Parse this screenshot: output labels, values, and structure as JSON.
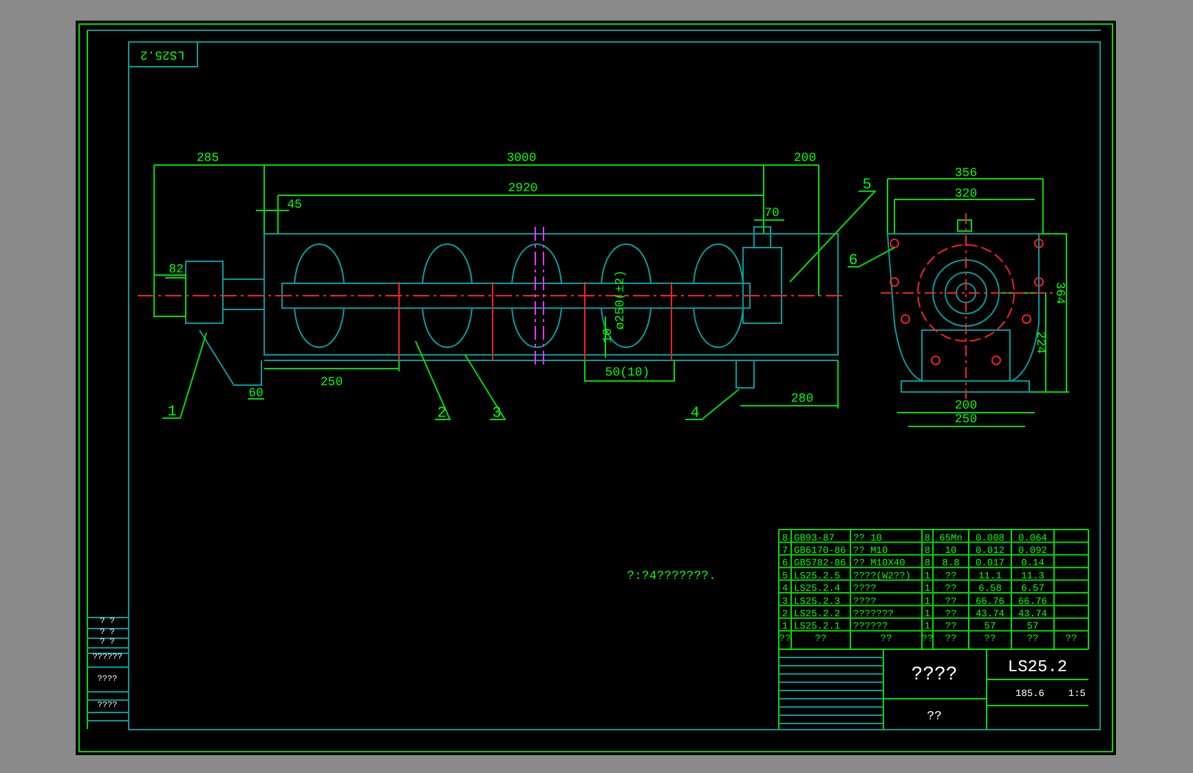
{
  "stamp": "LS25.2",
  "main_dimensions": [
    "285",
    "3000",
    "200",
    "2920",
    "45",
    "70",
    "82",
    "250",
    "60",
    "280",
    "10",
    "ø250(±2)",
    "50(10)"
  ],
  "side_dimensions": [
    "356",
    "320",
    "364",
    "224",
    "200",
    "250"
  ],
  "callouts": [
    "1",
    "2",
    "3",
    "4",
    "5",
    "6"
  ],
  "note": "?:?4???????.",
  "bom": {
    "rows": [
      [
        "8",
        "GB93-87",
        "?? 10",
        "8",
        "65Mn",
        "0.008",
        "0.064"
      ],
      [
        "7",
        "GB6170-86",
        "?? M10",
        "8",
        "10",
        "0.012",
        "0.092"
      ],
      [
        "6",
        "GB5782-86",
        "?? M10X40",
        "8",
        "8.8",
        "0.017",
        "0.14"
      ],
      [
        "5",
        "LS25.2.5",
        "????(W2??)",
        "1",
        "??",
        "11.1",
        "11.3"
      ],
      [
        "4",
        "LS25.2.4",
        "????",
        "1",
        "??",
        "6.58",
        "6.57"
      ],
      [
        "3",
        "LS25.2.3",
        "????",
        "1",
        "??",
        "66.76",
        "66.76"
      ],
      [
        "2",
        "LS25.2.2",
        "???????",
        "1",
        "??",
        "43.74",
        "43.74"
      ],
      [
        "1",
        "LS25.2.1",
        "??????",
        "1",
        "??",
        "57",
        "57"
      ]
    ],
    "header": [
      "??",
      "??",
      "??",
      "??",
      "??",
      "??",
      "??",
      "??"
    ]
  },
  "title_block": {
    "name": "????",
    "company": "??",
    "code": "LS25.2",
    "weight": "185.6",
    "scale": "1:5"
  },
  "side_stamp": [
    "? ?",
    "? ?",
    "? ?",
    "??????",
    "????",
    "????"
  ]
}
